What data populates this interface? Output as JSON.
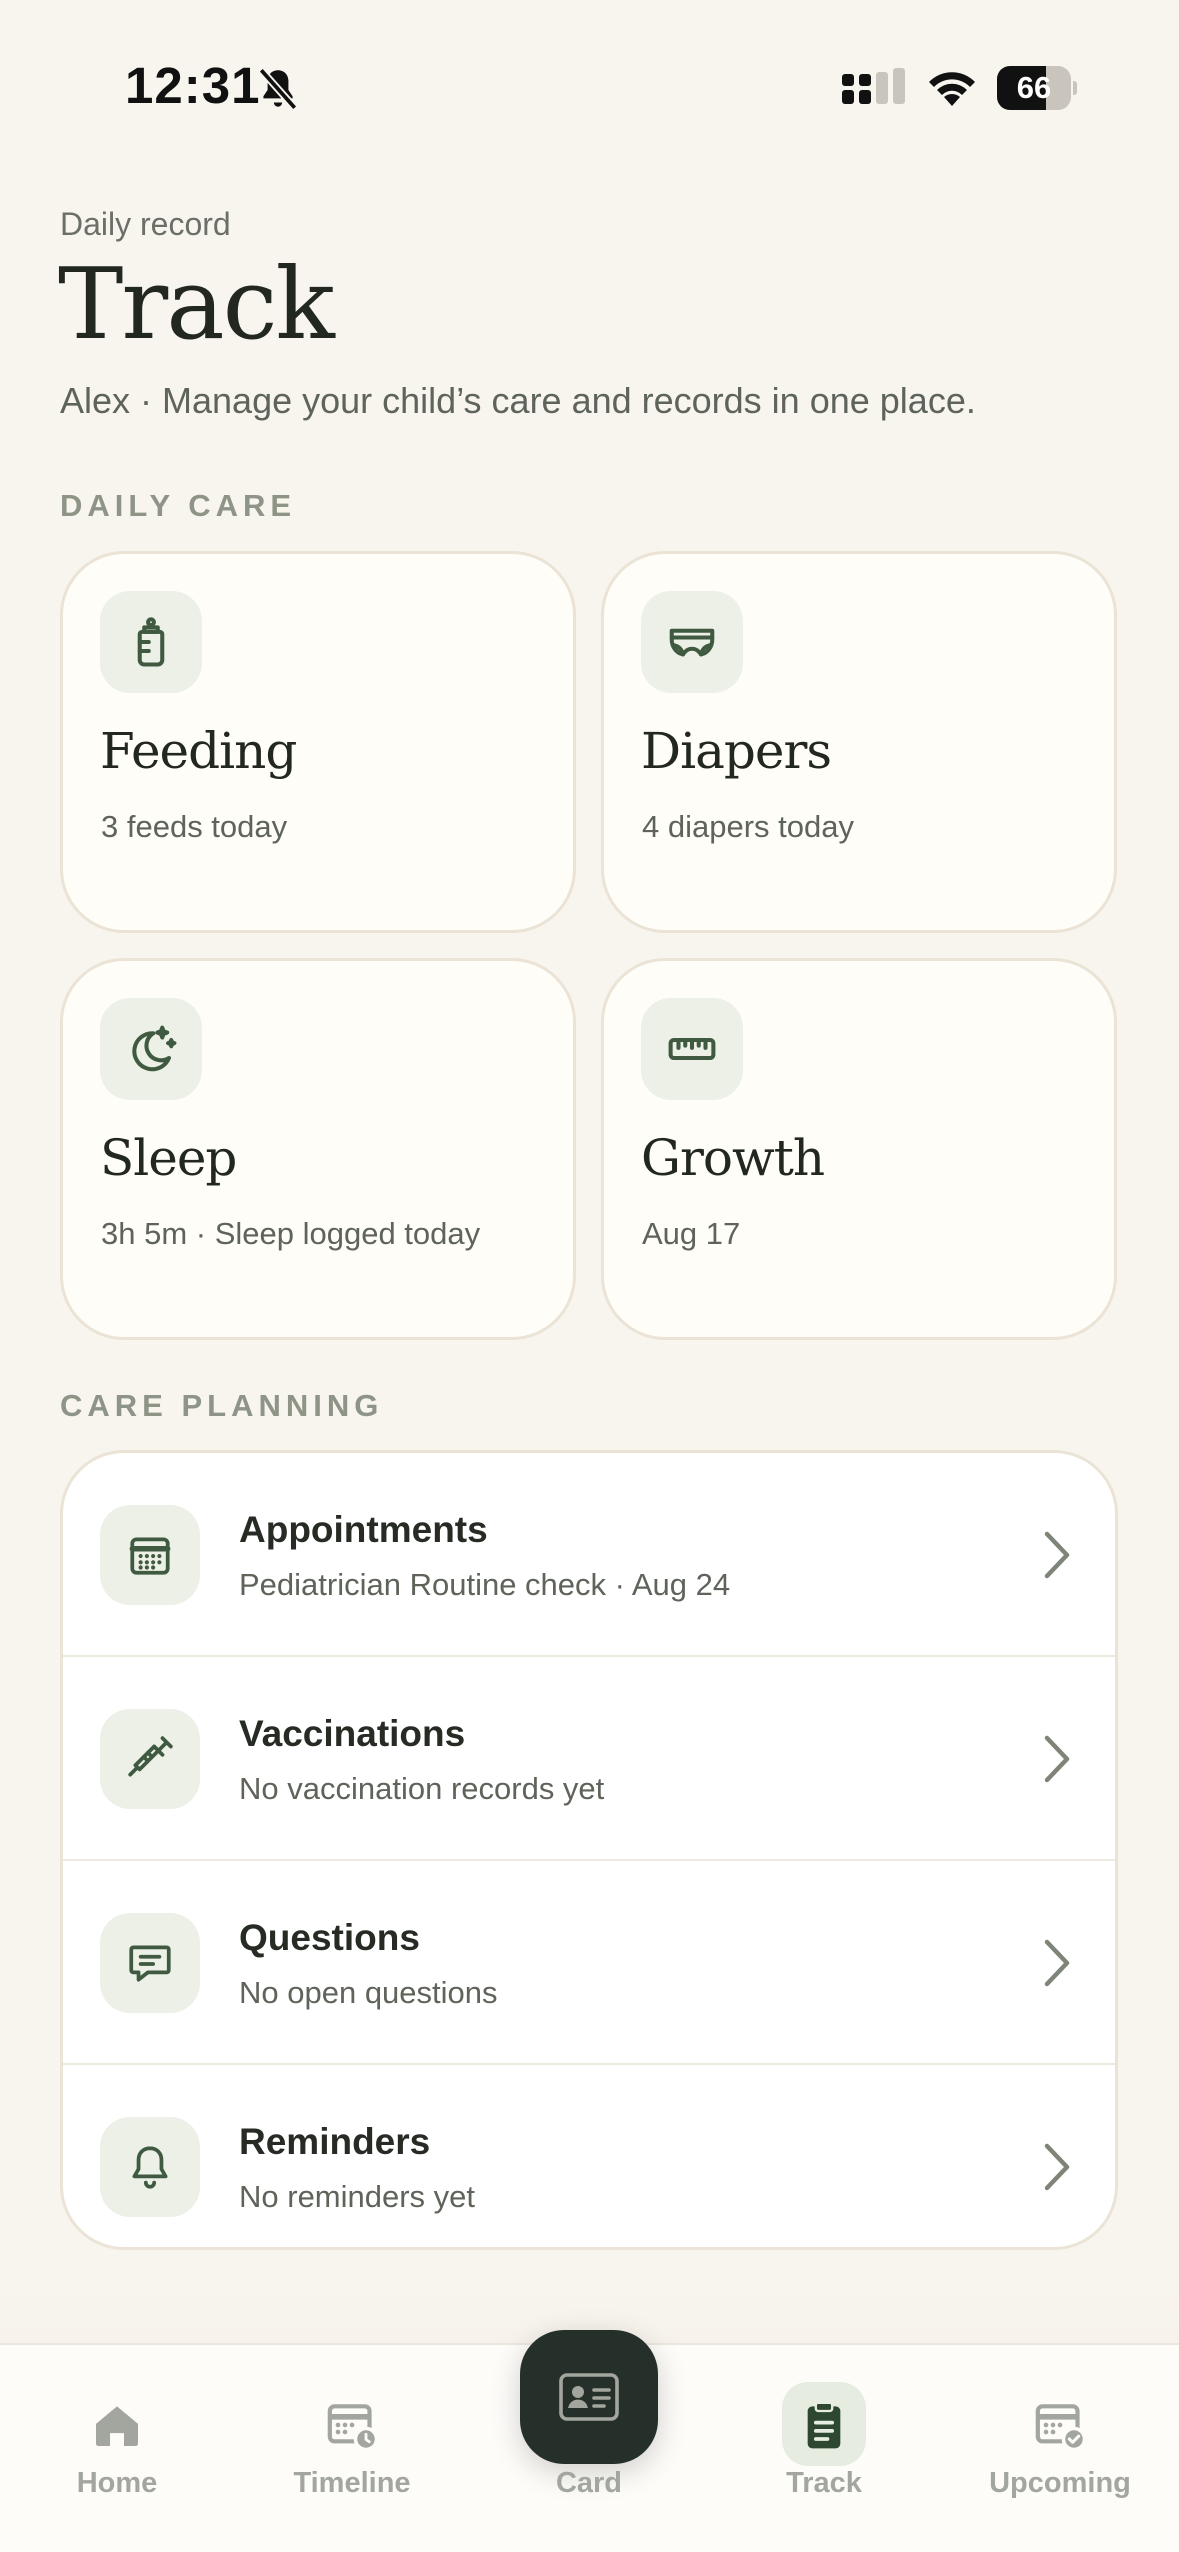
{
  "status_bar": {
    "time": "12:31",
    "battery_percent": "66",
    "battery_level": 0.66
  },
  "header": {
    "eyebrow": "Daily record",
    "title": "Track",
    "subtitle": "Alex · Manage your child’s care and records in one place."
  },
  "daily_care": {
    "label": "DAILY CARE",
    "cards": [
      {
        "title": "Feeding",
        "subtitle": "3 feeds today",
        "icon": "bottle-icon"
      },
      {
        "title": "Diapers",
        "subtitle": "4 diapers today",
        "icon": "diaper-icon"
      },
      {
        "title": "Sleep",
        "subtitle": "3h 5m · Sleep logged today",
        "icon": "moon-stars-icon"
      },
      {
        "title": "Growth",
        "subtitle": "Aug 17",
        "icon": "ruler-icon"
      }
    ]
  },
  "care_planning": {
    "label": "CARE PLANNING",
    "items": [
      {
        "title": "Appointments",
        "subtitle": "Pediatrician Routine check · Aug 24",
        "icon": "calendar-icon"
      },
      {
        "title": "Vaccinations",
        "subtitle": "No vaccination records yet",
        "icon": "syringe-icon"
      },
      {
        "title": "Questions",
        "subtitle": "No open questions",
        "icon": "chat-bubble-icon"
      },
      {
        "title": "Reminders",
        "subtitle": "No reminders yet",
        "icon": "bell-icon"
      }
    ]
  },
  "tab_bar": {
    "tabs": [
      {
        "label": "Home",
        "icon": "house-icon"
      },
      {
        "label": "Timeline",
        "icon": "calendar-clock-icon"
      },
      {
        "label": "Card",
        "icon": "id-card-icon"
      },
      {
        "label": "Track",
        "icon": "clipboard-icon",
        "active": true
      },
      {
        "label": "Upcoming",
        "icon": "calendar-check-icon"
      }
    ]
  },
  "colors": {
    "background": "#f8f5ef",
    "accent": "#2d4731",
    "icon_tint": "#ecf0e6",
    "card_border": "#ebe3d6"
  }
}
